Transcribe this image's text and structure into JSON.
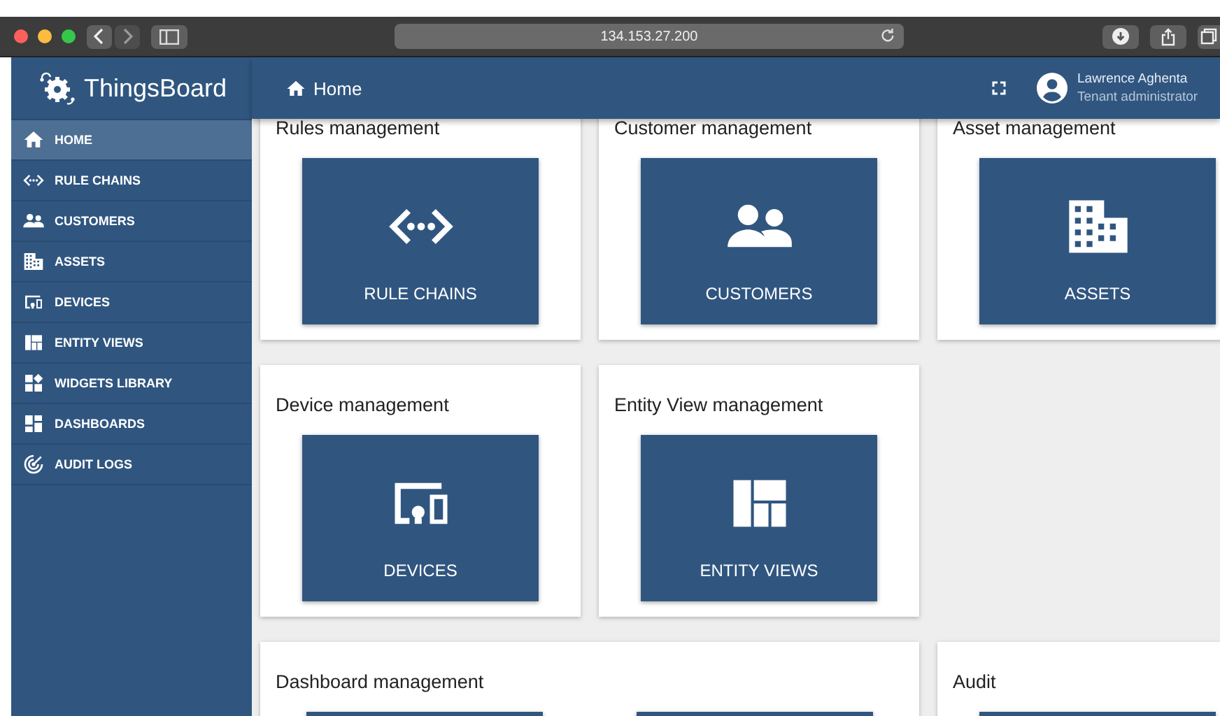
{
  "browser": {
    "url": "134.153.27.200"
  },
  "sidebar": {
    "logo": "ThingsBoard",
    "items": [
      {
        "label": "HOME",
        "kind": "home",
        "selected": true
      },
      {
        "label": "RULE CHAINS",
        "kind": "rule-chains",
        "selected": false
      },
      {
        "label": "CUSTOMERS",
        "kind": "customers",
        "selected": false
      },
      {
        "label": "ASSETS",
        "kind": "assets",
        "selected": false
      },
      {
        "label": "DEVICES",
        "kind": "devices",
        "selected": false
      },
      {
        "label": "ENTITY VIEWS",
        "kind": "entity-views",
        "selected": false
      },
      {
        "label": "WIDGETS LIBRARY",
        "kind": "widgets",
        "selected": false
      },
      {
        "label": "DASHBOARDS",
        "kind": "dashboards",
        "selected": false
      },
      {
        "label": "AUDIT LOGS",
        "kind": "audit",
        "selected": false
      }
    ]
  },
  "header": {
    "breadcrumb": "Home",
    "user_name": "Lawrence Aghenta",
    "user_role": "Tenant administrator"
  },
  "sections": [
    {
      "title": "Rules management",
      "wide": false,
      "tiles": [
        {
          "label": "RULE CHAINS",
          "kind": "rule-chains"
        }
      ]
    },
    {
      "title": "Customer management",
      "wide": false,
      "tiles": [
        {
          "label": "CUSTOMERS",
          "kind": "customers"
        }
      ]
    },
    {
      "title": "Asset management",
      "wide": false,
      "tiles": [
        {
          "label": "ASSETS",
          "kind": "assets"
        }
      ]
    },
    {
      "title": "Device management",
      "wide": false,
      "tiles": [
        {
          "label": "DEVICES",
          "kind": "devices"
        }
      ]
    },
    {
      "title": "Entity View management",
      "wide": false,
      "tiles": [
        {
          "label": "ENTITY VIEWS",
          "kind": "entity-views"
        }
      ]
    },
    {
      "title": "Dashboard management",
      "wide": true,
      "tiles": [
        {
          "kind": "blank"
        },
        {
          "kind": "blank"
        }
      ]
    },
    {
      "title": "Audit",
      "wide": false,
      "tiles": [
        {
          "kind": "blank"
        }
      ]
    }
  ]
}
